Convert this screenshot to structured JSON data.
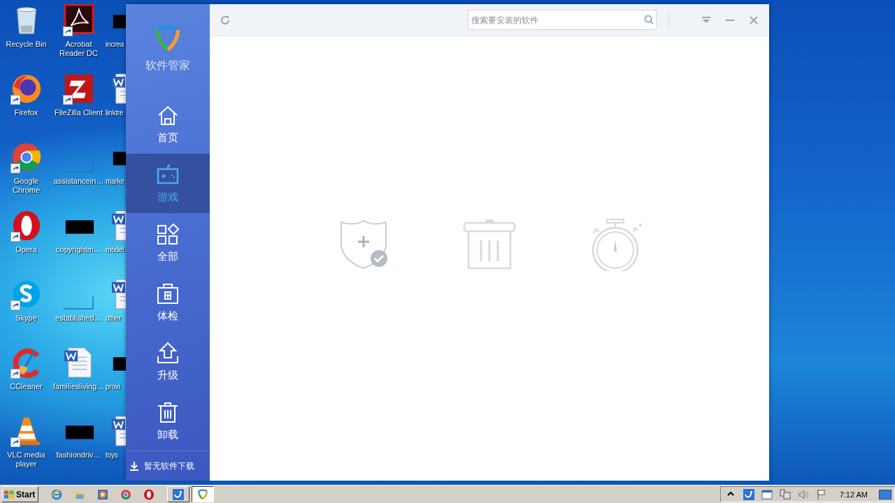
{
  "desktop": {
    "icons": [
      {
        "label": "Recycle Bin",
        "kind": "recycle",
        "shortcut": false
      },
      {
        "label": "Acrobat Reader DC",
        "kind": "acrobat",
        "shortcut": true
      },
      {
        "label": "increa",
        "kind": "black",
        "shortcut": false
      },
      {
        "label": "Firefox",
        "kind": "firefox",
        "shortcut": true
      },
      {
        "label": "FileZilla Client",
        "kind": "filezilla",
        "shortcut": true
      },
      {
        "label": "linktre",
        "kind": "word",
        "shortcut": false
      },
      {
        "label": "Google Chrome",
        "kind": "chrome",
        "shortcut": true
      },
      {
        "label": "assistancein…",
        "kind": "blank",
        "shortcut": false
      },
      {
        "label": "marke",
        "kind": "black",
        "shortcut": false
      },
      {
        "label": "Opera",
        "kind": "opera",
        "shortcut": true
      },
      {
        "label": "copyrightm…",
        "kind": "black",
        "shortcut": false
      },
      {
        "label": "model",
        "kind": "word",
        "shortcut": false
      },
      {
        "label": "Skype",
        "kind": "skype",
        "shortcut": true
      },
      {
        "label": "established…",
        "kind": "blank",
        "shortcut": false
      },
      {
        "label": "other",
        "kind": "word",
        "shortcut": false
      },
      {
        "label": "CCleaner",
        "kind": "ccleaner",
        "shortcut": true
      },
      {
        "label": "familiesliving…",
        "kind": "word",
        "shortcut": false
      },
      {
        "label": "provi",
        "kind": "black",
        "shortcut": false
      },
      {
        "label": "VLC media player",
        "kind": "vlc",
        "shortcut": true
      },
      {
        "label": "fashiondriv…",
        "kind": "black",
        "shortcut": false
      },
      {
        "label": "toys",
        "kind": "word",
        "shortcut": false
      }
    ]
  },
  "app": {
    "name": "软件管家",
    "nav": [
      {
        "label": "首页",
        "kind": "home",
        "selected": false
      },
      {
        "label": "游戏",
        "kind": "gamepad",
        "selected": true
      },
      {
        "label": "全部",
        "kind": "grid",
        "selected": false
      },
      {
        "label": "体检",
        "kind": "medkit",
        "selected": false
      },
      {
        "label": "升级",
        "kind": "upload",
        "selected": false
      },
      {
        "label": "卸载",
        "kind": "trash",
        "selected": false
      }
    ],
    "download_status": "暂无软件下载",
    "search": {
      "placeholder": "搜索要安装的软件"
    },
    "empty_icons": [
      {
        "kind": "shield"
      },
      {
        "kind": "trash"
      },
      {
        "kind": "stopwatch"
      }
    ]
  },
  "taskbar": {
    "start": "Start",
    "quick_launch": [
      {
        "kind": "ie"
      },
      {
        "kind": "folder"
      },
      {
        "kind": "media"
      },
      {
        "kind": "chrome"
      },
      {
        "kind": "opera"
      }
    ],
    "tasks": [
      {
        "kind": "tool",
        "selected": false
      },
      {
        "kind": "shield",
        "selected": true
      }
    ],
    "tray": [
      {
        "kind": "chevron"
      },
      {
        "kind": "tool"
      },
      {
        "kind": "window"
      },
      {
        "kind": "network"
      },
      {
        "kind": "speaker"
      },
      {
        "kind": "flag"
      }
    ],
    "clock": "7:12 AM"
  }
}
